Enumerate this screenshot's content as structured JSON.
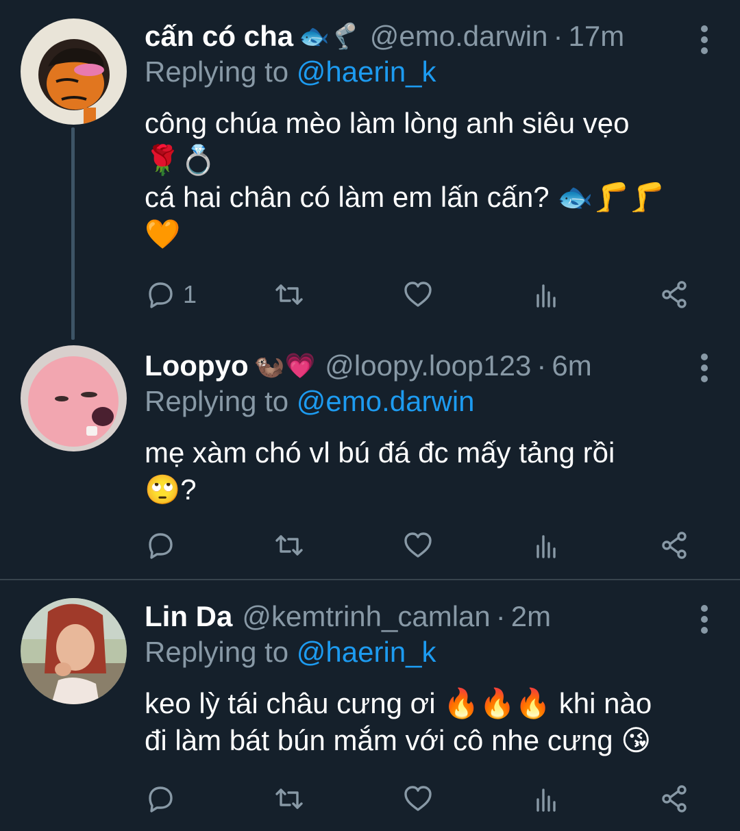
{
  "tweets": [
    {
      "name": "cấn có cha",
      "name_emoji": "🐟🦿",
      "handle": "@emo.darwin",
      "time": "17m",
      "separator": "·",
      "replying_prefix": "Replying to",
      "replying_to": "@haerin_k",
      "lines": [
        "công chúa mèo làm lòng anh siêu vẹo",
        "🌹💍",
        "cá hai chân có làm em lấn cấn? 🐟🦵🦵",
        "🧡"
      ],
      "reply_count": "1"
    },
    {
      "name": "Loopyo",
      "name_emoji": "🦦💗",
      "handle": "@loopy.loop123",
      "time": "6m",
      "separator": "·",
      "replying_prefix": "Replying to",
      "replying_to": "@emo.darwin",
      "lines": [
        "mẹ xàm chó vl bú đá đc mấy tảng rồi",
        "🙄?"
      ],
      "reply_count": ""
    },
    {
      "name": "Lin Da",
      "name_emoji": "",
      "handle": "@kemtrinh_camlan",
      "time": "2m",
      "separator": "·",
      "replying_prefix": "Replying to",
      "replying_to": "@haerin_k",
      "lines": [
        "keo lỳ tái châu cưng ơi 🔥🔥🔥 khi nào",
        "đi làm bát bún mắm với cô nhe cưng 😘"
      ],
      "reply_count": ""
    }
  ],
  "colors": {
    "background": "#15202b",
    "muted": "#8899a6",
    "link": "#1d9bf0",
    "divider": "#38444d"
  },
  "icons": [
    "reply-icon",
    "retweet-icon",
    "like-icon",
    "analytics-icon",
    "share-icon",
    "more-icon"
  ]
}
